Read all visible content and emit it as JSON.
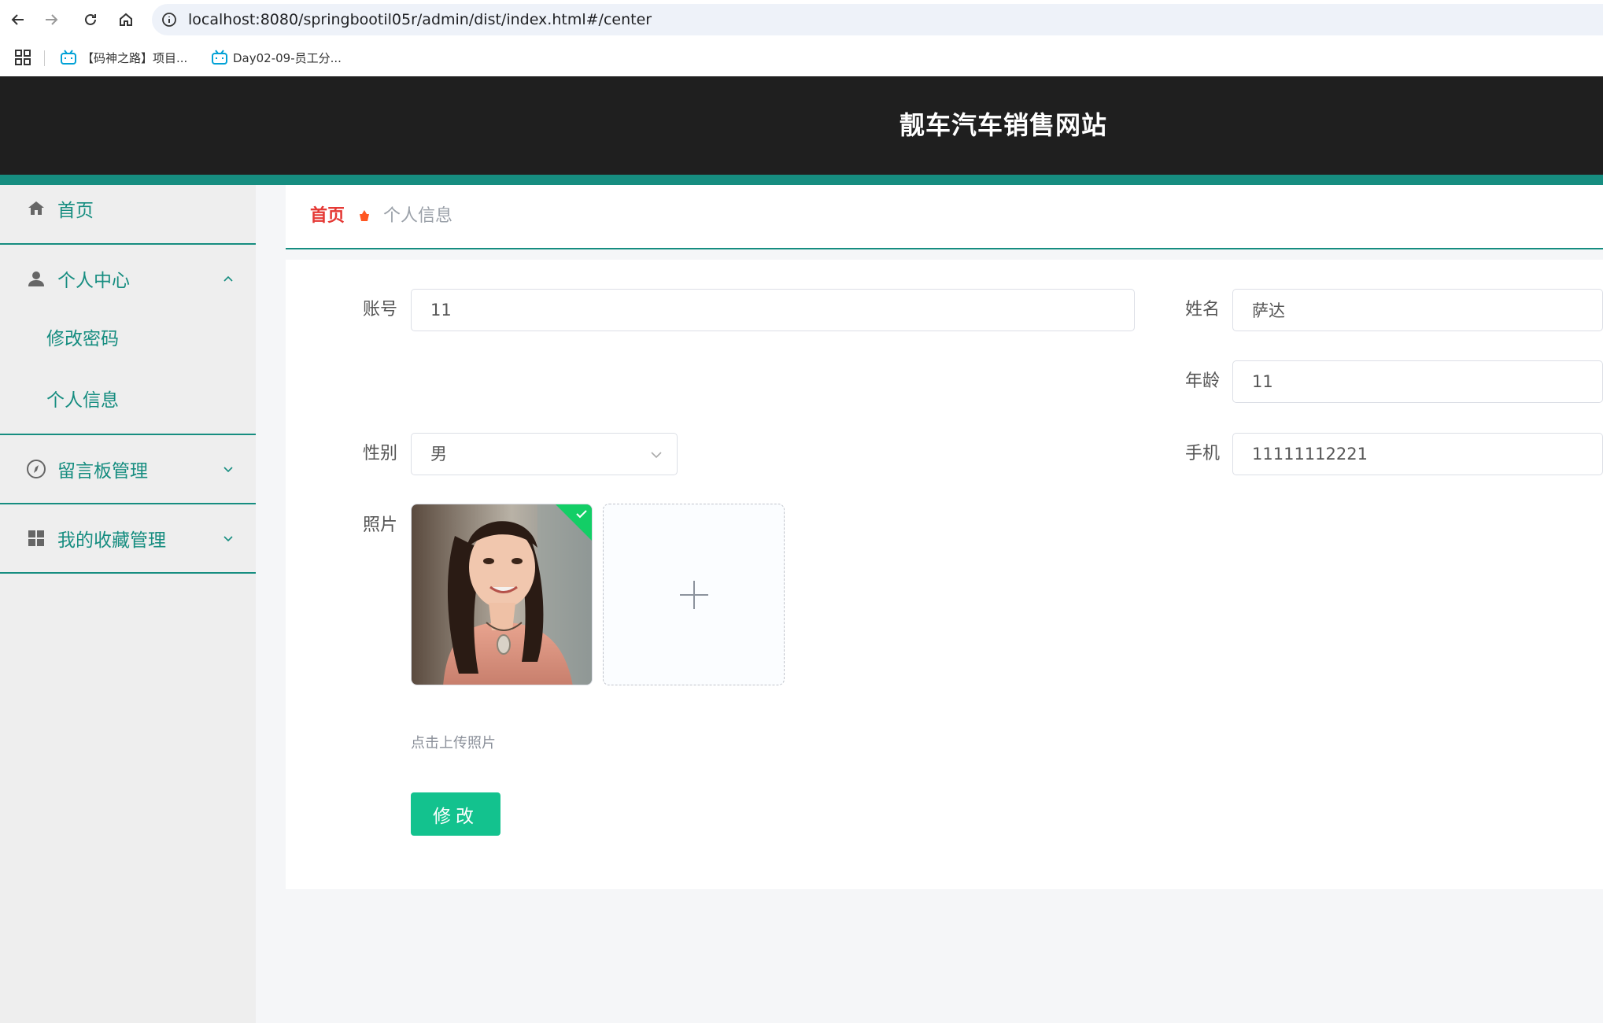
{
  "browser": {
    "url": "localhost:8080/springbootil05r/admin/dist/index.html#/center",
    "bookmarks": [
      {
        "label": "【码神之路】项目..."
      },
      {
        "label": "Day02-09-员工分..."
      }
    ]
  },
  "header": {
    "title": "靓车汽车销售网站"
  },
  "sidebar": {
    "home": "首页",
    "personal_center": "个人中心",
    "change_password": "修改密码",
    "personal_info": "个人信息",
    "message_board": "留言板管理",
    "favorites": "我的收藏管理"
  },
  "breadcrumb": {
    "home": "首页",
    "current": "个人信息"
  },
  "form": {
    "account_label": "账号",
    "account_value": "11",
    "name_label": "姓名",
    "name_value": "萨达",
    "age_label": "年龄",
    "age_value": "11",
    "gender_label": "性别",
    "gender_value": "男",
    "phone_label": "手机",
    "phone_value": "11111112221",
    "photo_label": "照片",
    "upload_tip": "点击上传照片",
    "submit_label": "修改"
  },
  "colors": {
    "accent": "#168d80",
    "header_bg": "#1f1f1f",
    "button": "#13c28e",
    "breadcrumb_home": "#e53935",
    "breadcrumb_separator": "#ff5722"
  }
}
